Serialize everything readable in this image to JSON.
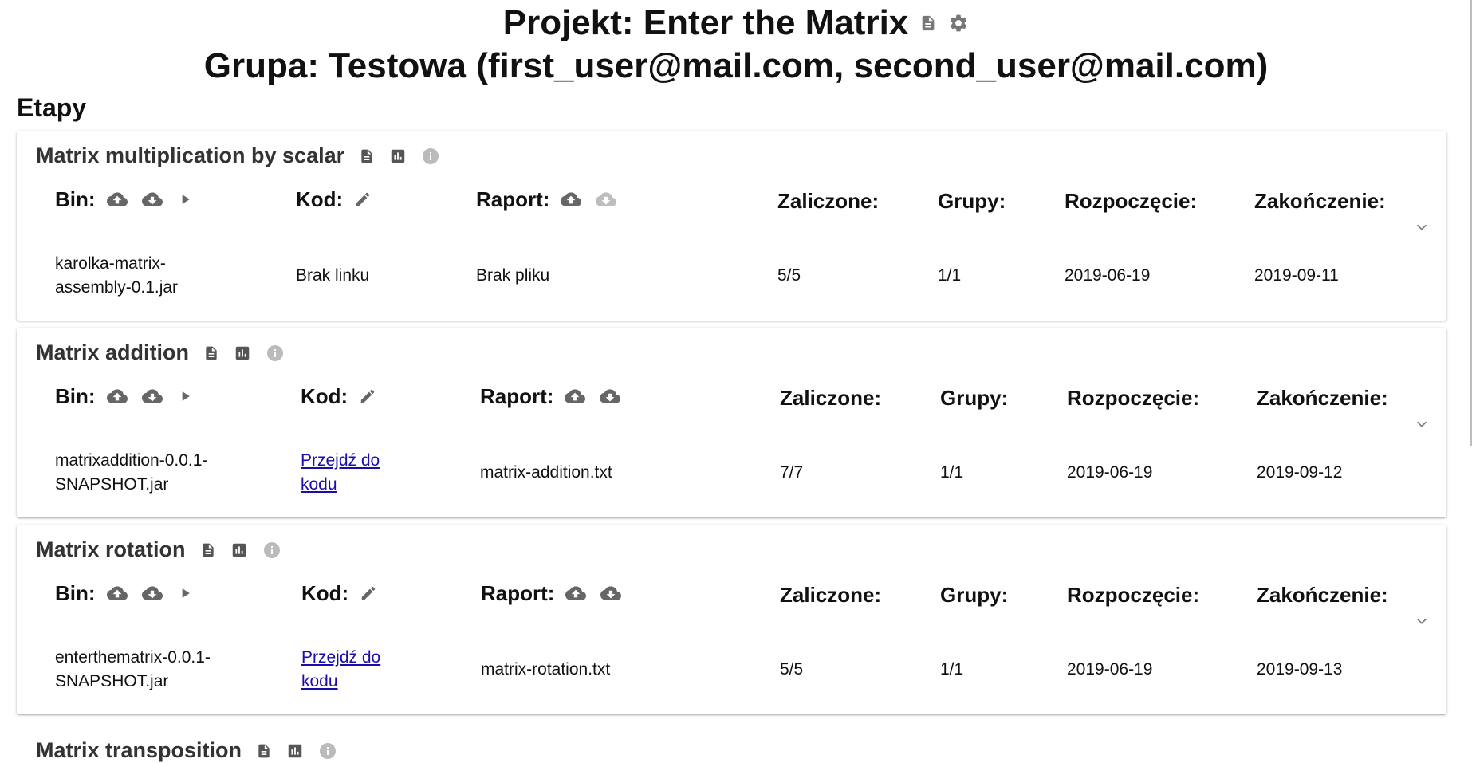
{
  "header": {
    "project_line": "Projekt: Enter the Matrix",
    "group_line": "Grupa: Testowa (first_user@mail.com, second_user@mail.com)"
  },
  "section_title": "Etapy",
  "labels": {
    "bin": "Bin:",
    "kod": "Kod:",
    "raport": "Raport:",
    "zaliczone": "Zaliczone:",
    "grupy": "Grupy:",
    "rozpoczecie": "Rozpoczęcie:",
    "zakonczenie": "Zakończenie:"
  },
  "stages": [
    {
      "title": "Matrix multiplication by scalar",
      "bin_line1": "karolka-matrix-",
      "bin_line2": "assembly-0.1.jar",
      "kod": "Brak linku",
      "kod_is_link": false,
      "raport": "Brak pliku",
      "raport_download_enabled": false,
      "zaliczone": "5/5",
      "grupy": "1/1",
      "rozpoczecie": "2019-06-19",
      "zakonczenie": "2019-09-11"
    },
    {
      "title": "Matrix addition",
      "bin_line1": "matrixaddition-0.0.1-",
      "bin_line2": "SNAPSHOT.jar",
      "kod_line1": "Przejdź do",
      "kod_line2": "kodu",
      "kod_is_link": true,
      "raport": "matrix-addition.txt",
      "raport_download_enabled": true,
      "zaliczone": "7/7",
      "grupy": "1/1",
      "rozpoczecie": "2019-06-19",
      "zakonczenie": "2019-09-12"
    },
    {
      "title": "Matrix rotation",
      "bin_line1": "enterthematrix-0.0.1-",
      "bin_line2": "SNAPSHOT.jar",
      "kod_line1": "Przejdź do",
      "kod_line2": "kodu",
      "kod_is_link": true,
      "raport": "matrix-rotation.txt",
      "raport_download_enabled": true,
      "zaliczone": "5/5",
      "grupy": "1/1",
      "rozpoczecie": "2019-06-19",
      "zakonczenie": "2019-09-13"
    }
  ],
  "partial_stage_title": "Matrix transposition",
  "icons": {
    "doc": "document-icon",
    "settings": "gear-icon",
    "chart": "bar-chart-icon",
    "info": "info-icon",
    "upload": "cloud-upload-icon",
    "download": "cloud-download-icon",
    "run": "play-icon",
    "edit": "pencil-icon",
    "expand": "chevron-down-icon"
  },
  "colors": {
    "link": "#1a0dab",
    "icon": "#666666",
    "disabled_icon": "#bdbdbd"
  }
}
